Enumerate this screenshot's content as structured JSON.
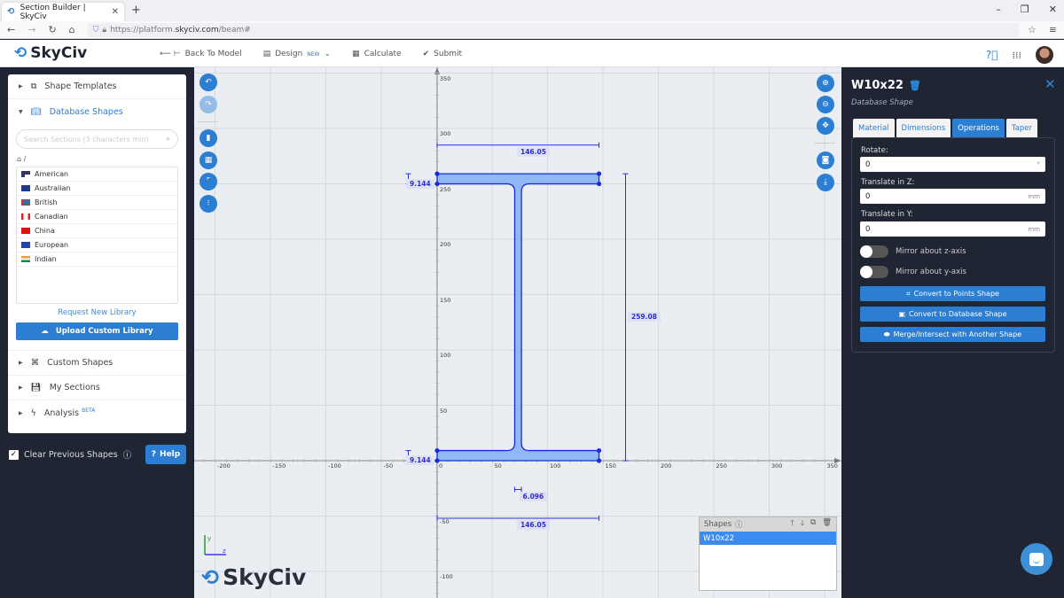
{
  "browser": {
    "tab_title": "Section Builder | SkyCiv",
    "url_prefix": "https://platform.",
    "url_domain": "skyciv.com",
    "url_path": "/beam#"
  },
  "header": {
    "logo": "SkyCiv",
    "nav": [
      {
        "label": "Back To Model",
        "icon": "arrow-left-icon"
      },
      {
        "label": "Design",
        "badge": "NEW",
        "icon": "document-icon"
      },
      {
        "label": "Calculate",
        "icon": "calculator-icon"
      },
      {
        "label": "Submit",
        "icon": "check-icon"
      }
    ]
  },
  "left_panel": {
    "sections": {
      "shape_templates": "Shape Templates",
      "database_shapes": "Database Shapes",
      "custom_shapes": "Custom Shapes",
      "my_sections": "My Sections",
      "analysis": "Analysis",
      "analysis_badge": "BETA"
    },
    "search_placeholder": "Search Sections (3 characters min)",
    "breadcrumb": "/",
    "libraries": [
      "American",
      "Australian",
      "British",
      "Canadian",
      "China",
      "European",
      "Indian"
    ],
    "request_link": "Request New Library",
    "upload_button": "Upload Custom Library",
    "clear_previous": "Clear Previous Shapes",
    "clear_checked": true,
    "help_button": "Help"
  },
  "canvas": {
    "x_ticks": [
      "-200",
      "-150",
      "-100",
      "-50",
      "0",
      "50",
      "100",
      "150",
      "200",
      "250",
      "300",
      "350"
    ],
    "y_ticks": [
      "350",
      "300",
      "250",
      "200",
      "150",
      "100",
      "50",
      "-50",
      "-100"
    ],
    "dimensions": {
      "top_flange_width": "146.05",
      "bottom_flange_width": "146.05",
      "top_flange_thickness": "9.144",
      "bottom_flange_thickness": "9.144",
      "web_thickness": "6.096",
      "overall_depth": "259.08"
    },
    "axis_labels": {
      "y": "y",
      "z": "z"
    },
    "watermark": "SkyCiv",
    "shapes_panel": {
      "title": "Shapes",
      "items": [
        "W10x22"
      ],
      "selected": "W10x22"
    }
  },
  "right_panel": {
    "shape_name": "W10x22",
    "shape_type": "Database Shape",
    "tabs": [
      "Material",
      "Dimensions",
      "Operations",
      "Taper"
    ],
    "active_tab": "Operations",
    "rotate_label": "Rotate:",
    "rotate_value": "0",
    "rotate_unit": "°",
    "translate_z_label": "Translate in Z:",
    "translate_z_value": "0",
    "translate_z_unit": "mm",
    "translate_y_label": "Translate in Y:",
    "translate_y_value": "0",
    "translate_y_unit": "mm",
    "mirror_z_label": "Mirror about z-axis",
    "mirror_z": false,
    "mirror_y_label": "Mirror about y-axis",
    "mirror_y": false,
    "buttons": [
      "Convert to Points Shape",
      "Convert to Database Shape",
      "Merge/Intersect with Another Shape"
    ]
  },
  "colors": {
    "accent": "#2b7ed1",
    "shape_fill": "#8fb8f5",
    "dimension": "#2a2ee0",
    "dark_bg": "#1f2533"
  }
}
